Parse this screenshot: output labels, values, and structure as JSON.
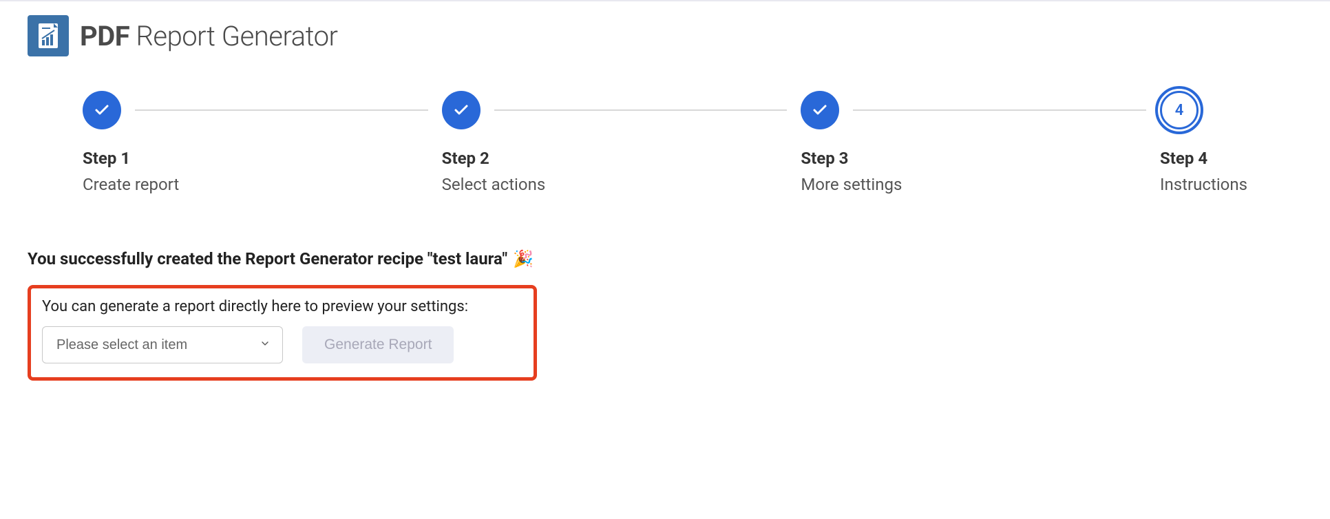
{
  "header": {
    "title_bold": "PDF",
    "title_rest": " Report Generator"
  },
  "stepper": {
    "steps": [
      {
        "title": "Step 1",
        "desc": "Create report",
        "state": "done"
      },
      {
        "title": "Step 2",
        "desc": "Select actions",
        "state": "done"
      },
      {
        "title": "Step 3",
        "desc": "More settings",
        "state": "done"
      },
      {
        "title": "Step 4",
        "desc": "Instructions",
        "state": "active",
        "number": "4"
      }
    ]
  },
  "content": {
    "success_message": "You successfully created the Report Generator recipe \"test laura\"",
    "celebration_emoji": "🎉",
    "preview_text": "You can generate a report directly here to preview your settings:",
    "select_placeholder": "Please select an item",
    "generate_button": "Generate Report"
  }
}
